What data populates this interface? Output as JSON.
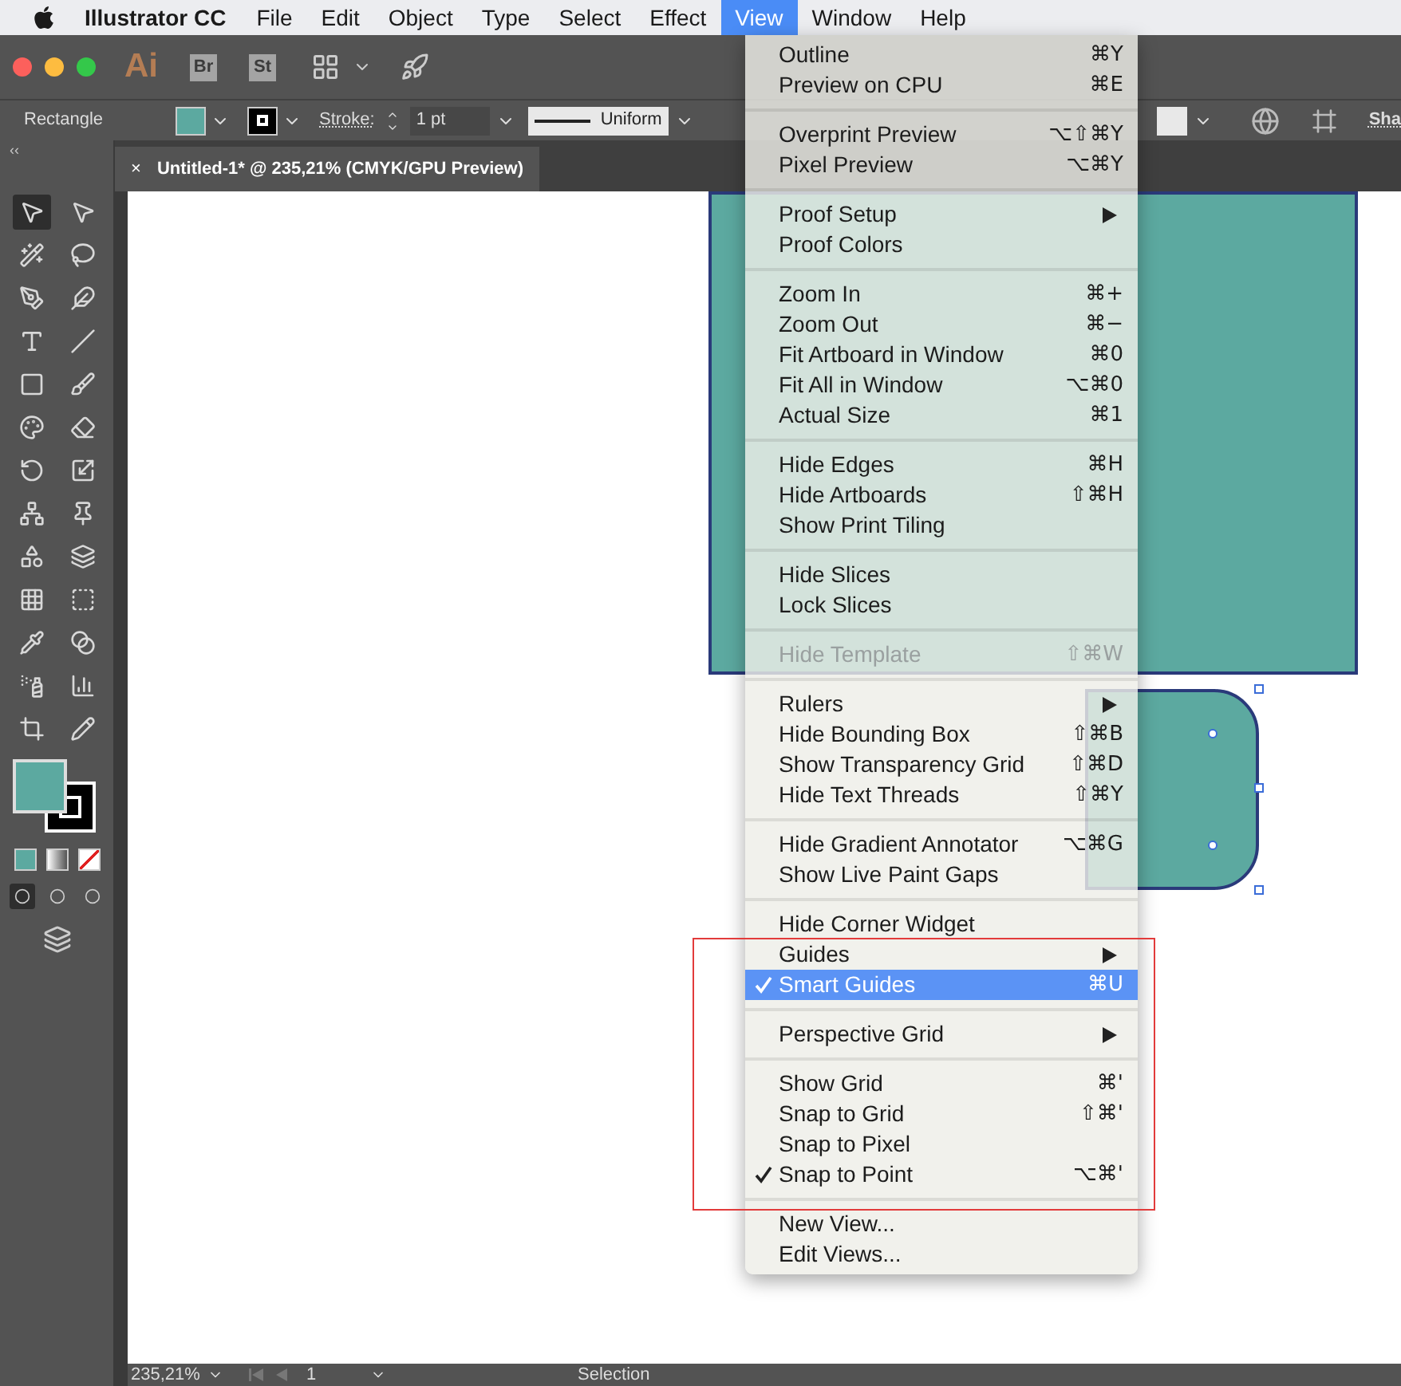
{
  "menubar": {
    "app_name": "Illustrator CC",
    "items": [
      {
        "label": "File",
        "selected": false
      },
      {
        "label": "Edit",
        "selected": false
      },
      {
        "label": "Object",
        "selected": false
      },
      {
        "label": "Type",
        "selected": false
      },
      {
        "label": "Select",
        "selected": false
      },
      {
        "label": "Effect",
        "selected": false
      },
      {
        "label": "View",
        "selected": true
      },
      {
        "label": "Window",
        "selected": false
      },
      {
        "label": "Help",
        "selected": false
      }
    ]
  },
  "app_bar": {
    "logo": "Ai",
    "apps": [
      "Br",
      "St"
    ]
  },
  "control_bar": {
    "object_type": "Rectangle",
    "stroke_label": "Stroke:",
    "stroke_weight": "1 pt",
    "profile": "Uniform",
    "cut_label": "Sha"
  },
  "document_tab": {
    "close": "×",
    "title": "Untitled-1* @ 235,21% (CMYK/GPU Preview)"
  },
  "toolbar": {
    "collapse": "‹‹",
    "tools": [
      {
        "selected": true
      },
      {
        "selected": false
      },
      {
        "selected": false
      },
      {
        "selected": false
      },
      {
        "selected": false
      },
      {
        "selected": false
      },
      {
        "selected": false
      },
      {
        "selected": false
      },
      {
        "selected": false
      },
      {
        "selected": false
      },
      {
        "selected": false
      },
      {
        "selected": false
      },
      {
        "selected": false
      },
      {
        "selected": false
      },
      {
        "selected": false
      },
      {
        "selected": false
      },
      {
        "selected": false
      },
      {
        "selected": false
      },
      {
        "selected": false
      },
      {
        "selected": false
      },
      {
        "selected": false
      },
      {
        "selected": false
      },
      {
        "selected": false
      },
      {
        "selected": false
      },
      {
        "selected": false
      },
      {
        "selected": false
      }
    ],
    "draw_modes": [
      {
        "selected": true
      },
      {
        "selected": false
      },
      {
        "selected": false
      }
    ]
  },
  "view_menu": {
    "sections": [
      [
        {
          "label": "Outline",
          "shortcut": "⌘Y"
        },
        {
          "label": "Preview on CPU",
          "shortcut": "⌘E"
        }
      ],
      [
        {
          "label": "Overprint Preview",
          "shortcut": "⌥⇧⌘Y"
        },
        {
          "label": "Pixel Preview",
          "shortcut": "⌥⌘Y"
        }
      ],
      [
        {
          "label": "Proof Setup",
          "submenu": true
        },
        {
          "label": "Proof Colors"
        }
      ],
      [
        {
          "label": "Zoom In",
          "shortcut": "⌘+"
        },
        {
          "label": "Zoom Out",
          "shortcut": "⌘−"
        },
        {
          "label": "Fit Artboard in Window",
          "shortcut": "⌘0"
        },
        {
          "label": "Fit All in Window",
          "shortcut": "⌥⌘0"
        },
        {
          "label": "Actual Size",
          "shortcut": "⌘1"
        }
      ],
      [
        {
          "label": "Hide Edges",
          "shortcut": "⌘H"
        },
        {
          "label": "Hide Artboards",
          "shortcut": "⇧⌘H"
        },
        {
          "label": "Show Print Tiling"
        }
      ],
      [
        {
          "label": "Hide Slices"
        },
        {
          "label": "Lock Slices"
        }
      ],
      [
        {
          "label": "Hide Template",
          "shortcut": "⇧⌘W",
          "disabled": true
        }
      ],
      [
        {
          "label": "Rulers",
          "submenu": true
        },
        {
          "label": "Hide Bounding Box",
          "shortcut": "⇧⌘B"
        },
        {
          "label": "Show Transparency Grid",
          "shortcut": "⇧⌘D"
        },
        {
          "label": "Hide Text Threads",
          "shortcut": "⇧⌘Y"
        }
      ],
      [
        {
          "label": "Hide Gradient Annotator",
          "shortcut": "⌥⌘G"
        },
        {
          "label": "Show Live Paint Gaps"
        }
      ],
      [
        {
          "label": "Hide Corner Widget"
        },
        {
          "label": "Guides",
          "submenu": true
        },
        {
          "label": "Smart Guides",
          "shortcut": "⌘U",
          "checked": true,
          "selected": true
        }
      ],
      [
        {
          "label": "Perspective Grid",
          "submenu": true
        }
      ],
      [
        {
          "label": "Show Grid",
          "shortcut": "⌘'"
        },
        {
          "label": "Snap to Grid",
          "shortcut": "⇧⌘'"
        },
        {
          "label": "Snap to Pixel"
        },
        {
          "label": "Snap to Point",
          "shortcut": "⌥⌘'",
          "checked": true
        }
      ],
      [
        {
          "label": "New View..."
        },
        {
          "label": "Edit Views..."
        }
      ]
    ]
  },
  "status_bar": {
    "zoom": "235,21%",
    "artboard": "1",
    "tool": "Selection"
  }
}
